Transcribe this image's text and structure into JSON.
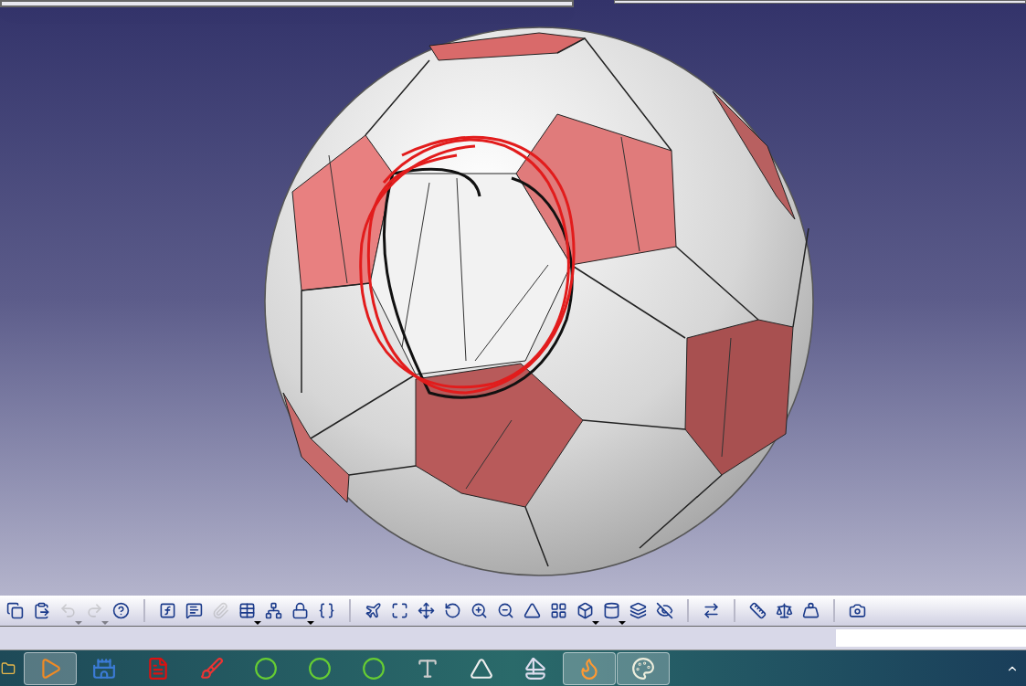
{
  "toolbar": {
    "groups": [
      [
        {
          "disabled": false,
          "dropdown": false
        },
        {
          "disabled": false,
          "dropdown": false
        },
        {
          "disabled": true,
          "dropdown": true
        },
        {
          "disabled": true,
          "dropdown": true
        },
        {
          "disabled": false,
          "dropdown": false
        }
      ],
      [
        {
          "disabled": false,
          "dropdown": false
        },
        {
          "disabled": false,
          "dropdown": false
        },
        {
          "disabled": true,
          "dropdown": false
        },
        {
          "disabled": false,
          "dropdown": true
        },
        {
          "disabled": false,
          "dropdown": false
        },
        {
          "disabled": false,
          "dropdown": true
        },
        {
          "disabled": false,
          "dropdown": false
        }
      ],
      [
        {
          "disabled": false,
          "dropdown": false
        },
        {
          "disabled": false,
          "dropdown": false
        },
        {
          "disabled": false,
          "dropdown": false
        },
        {
          "disabled": false,
          "dropdown": false
        },
        {
          "disabled": false,
          "dropdown": false
        },
        {
          "disabled": false,
          "dropdown": false
        },
        {
          "disabled": false,
          "dropdown": false
        },
        {
          "disabled": false,
          "dropdown": false
        },
        {
          "disabled": false,
          "dropdown": true
        },
        {
          "disabled": false,
          "dropdown": true
        },
        {
          "disabled": false,
          "dropdown": false
        },
        {
          "disabled": false,
          "dropdown": false
        }
      ],
      [
        {
          "disabled": false,
          "dropdown": false
        }
      ],
      [
        {
          "disabled": false,
          "dropdown": false
        },
        {
          "disabled": false,
          "dropdown": false
        },
        {
          "disabled": false,
          "dropdown": false
        }
      ],
      [
        {
          "disabled": false,
          "dropdown": false
        }
      ]
    ]
  },
  "taskbar": {
    "items": [
      {
        "selected": false
      },
      {
        "selected": true
      },
      {
        "selected": false
      },
      {
        "selected": false
      },
      {
        "selected": false
      },
      {
        "selected": false
      },
      {
        "selected": false
      },
      {
        "selected": false
      },
      {
        "selected": false
      },
      {
        "selected": false
      },
      {
        "selected": false
      },
      {
        "selected": true
      },
      {
        "selected": true
      }
    ]
  }
}
